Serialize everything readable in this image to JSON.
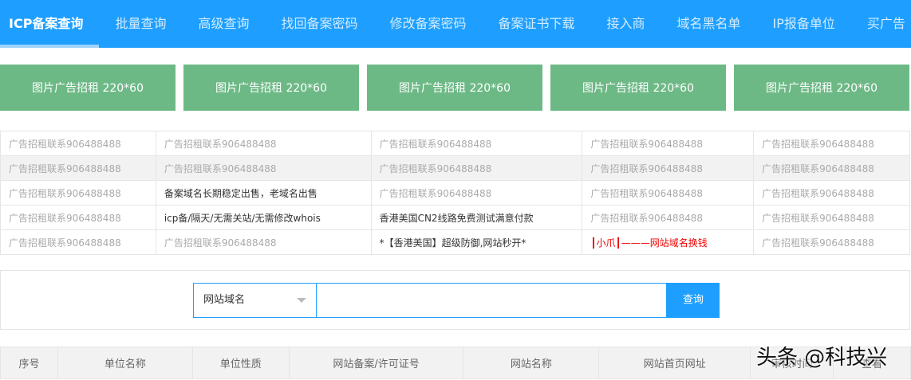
{
  "nav": [
    "ICP备案查询",
    "批量查询",
    "高级查询",
    "找回备案密码",
    "修改备案密码",
    "备案证书下载",
    "接入商",
    "域名黑名单",
    "IP报备单位",
    "买广告"
  ],
  "banners": [
    "图片广告招租 220*60",
    "图片广告招租 220*60",
    "图片广告招租 220*60",
    "图片广告招租 220*60",
    "图片广告招租 220*60"
  ],
  "ads": [
    [
      "广告招租联系906488488",
      "广告招租联系906488488",
      "广告招租联系906488488",
      "广告招租联系906488488",
      "广告招租联系906488488"
    ],
    [
      "广告招租联系906488488",
      "广告招租联系906488488",
      "广告招租联系906488488",
      "广告招租联系906488488",
      "广告招租联系906488488"
    ],
    [
      "广告招租联系906488488",
      "备案域名长期稳定出售，老域名出售",
      "广告招租联系906488488",
      "广告招租联系906488488",
      "广告招租联系906488488"
    ],
    [
      "广告招租联系906488488",
      "icp备/隔天/无需关站/无需修改whois",
      "香港美国CN2线路免费测试满意付款",
      "广告招租联系906488488",
      "广告招租联系906488488"
    ],
    [
      "广告招租联系906488488",
      "广告招租联系906488488",
      "*【香港美国】超级防御,网站秒开*",
      "┃小爪┃———网站域名换钱",
      "广告招租联系906488488"
    ]
  ],
  "search": {
    "select": "网站域名",
    "button": "查询",
    "value": ""
  },
  "columns": [
    "序号",
    "单位名称",
    "单位性质",
    "网站备案/许可证号",
    "网站名称",
    "网站首页网址",
    "审核时间",
    "查看"
  ],
  "watermark": "头条 @科技兴"
}
